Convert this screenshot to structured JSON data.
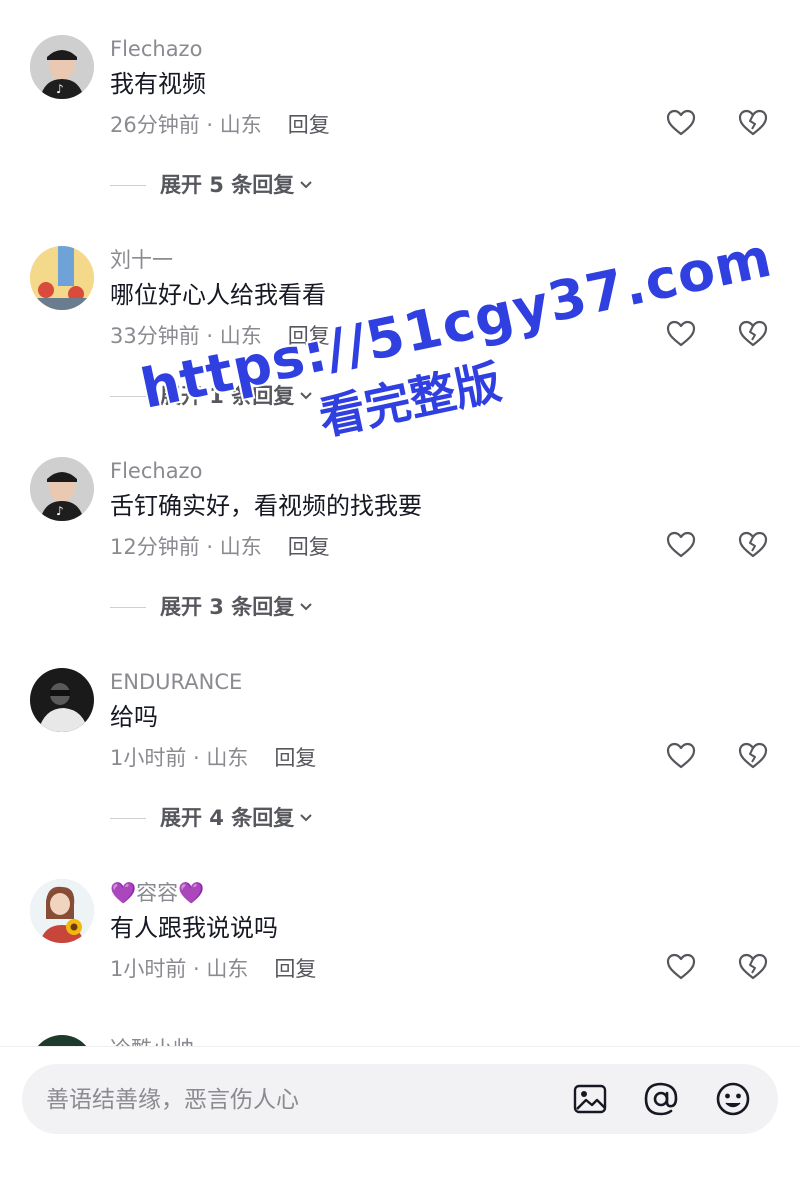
{
  "comments": [
    {
      "username": "Flechazo",
      "text": "我有视频",
      "time_location": "26分钟前 · 山东",
      "reply_label": "回复",
      "expand_label": "展开 5 条回复",
      "avatar": "man-with-cap-avatar"
    },
    {
      "username": "刘十一",
      "text": "哪位好心人给我看看",
      "time_location": "33分钟前 · 山东",
      "reply_label": "回复",
      "expand_label": "展开 1 条回复",
      "avatar": "cartoon-couple-avatar"
    },
    {
      "username": "Flechazo",
      "text": "舌钉确实好，看视频的找我要",
      "time_location": "12分钟前 · 山东",
      "reply_label": "回复",
      "expand_label": "展开 3 条回复",
      "avatar": "man-with-cap-avatar"
    },
    {
      "username": "ENDURANCE",
      "text": "给吗",
      "time_location": "1小时前 · 山东",
      "reply_label": "回复",
      "expand_label": "展开 4 条回复",
      "avatar": "dark-person-avatar"
    },
    {
      "username": "💜容容💜",
      "text": "有人跟我说说吗",
      "time_location": "1小时前 · 山东",
      "reply_label": "回复",
      "avatar": "girl-with-sunflower-avatar"
    }
  ],
  "partial_comment": {
    "username": "冷酷小帅"
  },
  "input": {
    "placeholder": "善语结善缘，恶言伤人心"
  },
  "toolbar_icons": [
    "image-icon",
    "at-icon",
    "emoji-icon"
  ],
  "watermark": {
    "line1": "https://51cgy37.com",
    "line2": "看完整版"
  },
  "colors": {
    "secondary_text": "#8a8b91",
    "primary_text": "#161823",
    "watermark": "#2f3fe0"
  }
}
